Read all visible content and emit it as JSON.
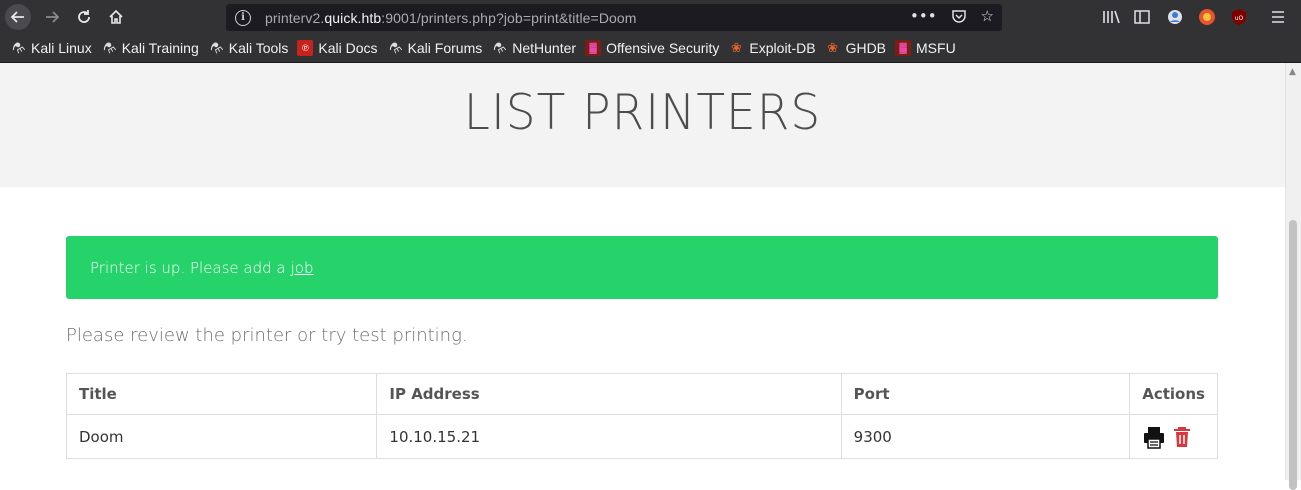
{
  "browser": {
    "url_prefix": "printerv2.",
    "url_host": "quick.htb",
    "url_rest": ":9001/printers.php?job=print&title=Doom",
    "bookmarks": [
      {
        "label": "Kali Linux",
        "icon": "kali-dragon-icon"
      },
      {
        "label": "Kali Training",
        "icon": "kali-dragon-icon"
      },
      {
        "label": "Kali Tools",
        "icon": "kali-dragon-icon"
      },
      {
        "label": "Kali Docs",
        "icon": "kali-docs-icon"
      },
      {
        "label": "Kali Forums",
        "icon": "kali-dragon-icon"
      },
      {
        "label": "NetHunter",
        "icon": "kali-dragon-icon"
      },
      {
        "label": "Offensive Security",
        "icon": "offsec-icon"
      },
      {
        "label": "Exploit-DB",
        "icon": "exploitdb-icon"
      },
      {
        "label": "GHDB",
        "icon": "exploitdb-icon"
      },
      {
        "label": "MSFU",
        "icon": "offsec-icon"
      }
    ]
  },
  "page": {
    "title": "LIST PRINTERS",
    "alert": {
      "text": "Printer is up. Please add a",
      "link": "job",
      "color": "#26d26a"
    },
    "lead": "Please review the printer or try test printing.",
    "table": {
      "headers": [
        "Title",
        "IP Address",
        "Port",
        "Actions"
      ],
      "rows": [
        {
          "title": "Doom",
          "ip": "10.10.15.21",
          "port": "9300"
        }
      ]
    }
  }
}
